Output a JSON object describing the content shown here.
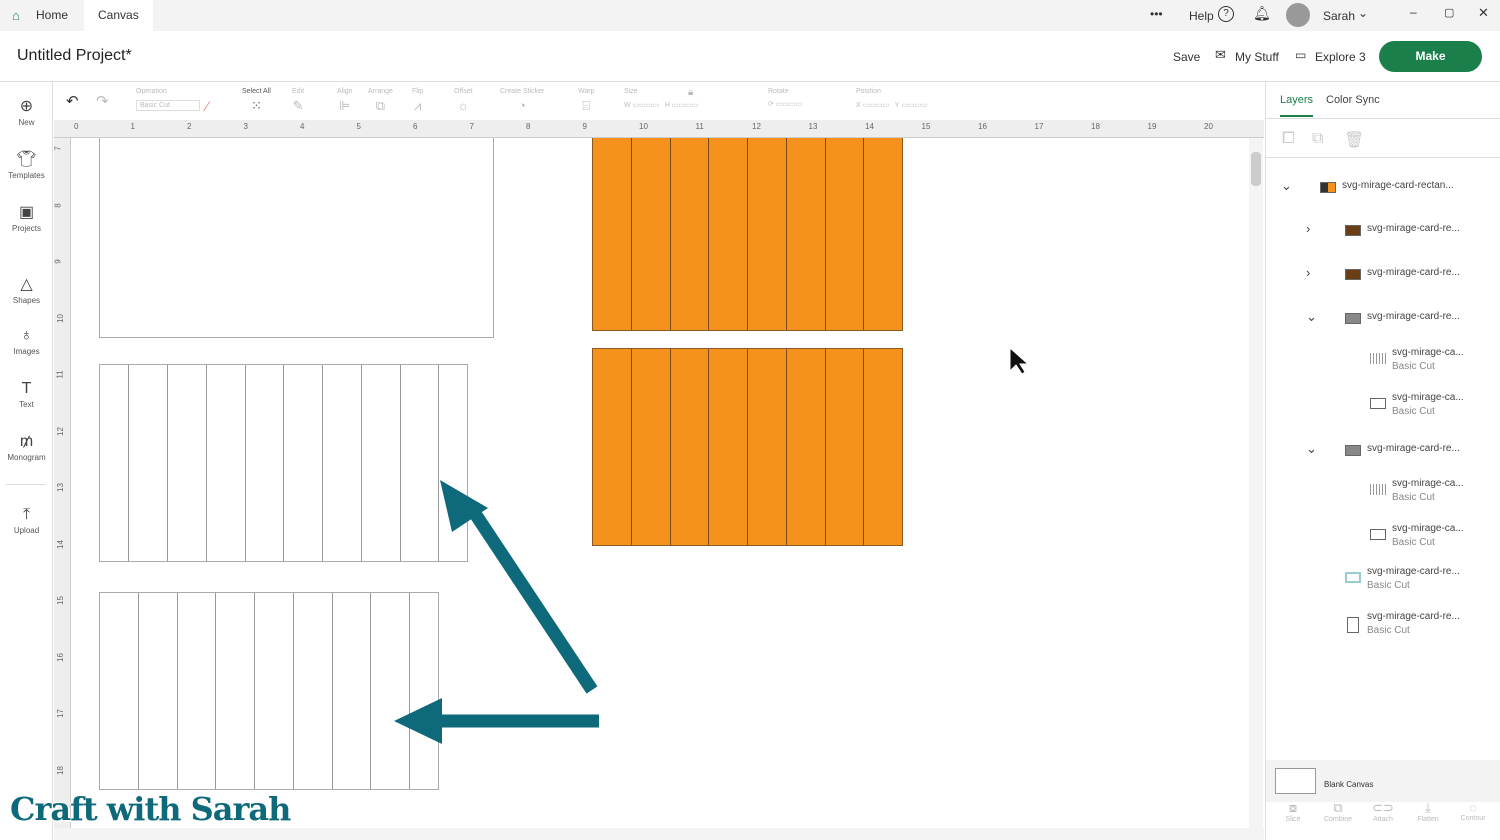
{
  "topbar": {
    "tabs": [
      "Home",
      "Canvas"
    ],
    "more": "•••",
    "help": "Help",
    "user": "Sarah"
  },
  "header": {
    "title": "Untitled Project*",
    "save": "Save",
    "my_stuff": "My Stuff",
    "machine": "Explore 3",
    "make": "Make"
  },
  "sidebar": [
    "New",
    "Templates",
    "Projects",
    "Shapes",
    "Images",
    "Text",
    "Monogram",
    "Upload"
  ],
  "toolbar": {
    "operation": "Operation",
    "operation_value": "Basic Cut",
    "select_all": "Select All",
    "edit": "Edit",
    "align": "Align",
    "arrange": "Arrange",
    "flip": "Flip",
    "offset": "Offset",
    "create_sticker": "Create Sticker",
    "warp": "Warp",
    "size": "Size",
    "w": "W",
    "h": "H",
    "rotate": "Rotate",
    "position": "Position",
    "x": "X",
    "y": "Y"
  },
  "ruler": {
    "h": [
      "0",
      "1",
      "2",
      "3",
      "4",
      "5",
      "6",
      "7",
      "8",
      "9",
      "10",
      "11",
      "12",
      "13",
      "14",
      "15",
      "16",
      "17",
      "18",
      "19",
      "20"
    ],
    "v": [
      "7",
      "8",
      "9",
      "10",
      "11",
      "12",
      "13",
      "14",
      "15",
      "16",
      "17",
      "18"
    ]
  },
  "panel": {
    "tabs": [
      "Layers",
      "Color Sync"
    ],
    "layers": [
      {
        "name": "svg-mirage-card-rectan...",
        "sub": ""
      },
      {
        "name": "svg-mirage-card-re...",
        "sub": ""
      },
      {
        "name": "svg-mirage-card-re...",
        "sub": ""
      },
      {
        "name": "svg-mirage-card-re...",
        "sub": ""
      },
      {
        "name": "svg-mirage-ca...",
        "sub": "Basic Cut"
      },
      {
        "name": "svg-mirage-ca...",
        "sub": "Basic Cut"
      },
      {
        "name": "svg-mirage-card-re...",
        "sub": ""
      },
      {
        "name": "svg-mirage-ca...",
        "sub": "Basic Cut"
      },
      {
        "name": "svg-mirage-ca...",
        "sub": "Basic Cut"
      },
      {
        "name": "svg-mirage-card-re...",
        "sub": "Basic Cut"
      },
      {
        "name": "svg-mirage-card-re...",
        "sub": "Basic Cut"
      }
    ],
    "blank_canvas": "Blank Canvas",
    "bottom": [
      "Slice",
      "Combine",
      "Attach",
      "Flatten",
      "Contour"
    ]
  },
  "watermark": "Craft with Sarah",
  "colors": {
    "brand": "#1b7f4c",
    "orange": "#f5921e",
    "arrow": "#0e6a7a"
  }
}
